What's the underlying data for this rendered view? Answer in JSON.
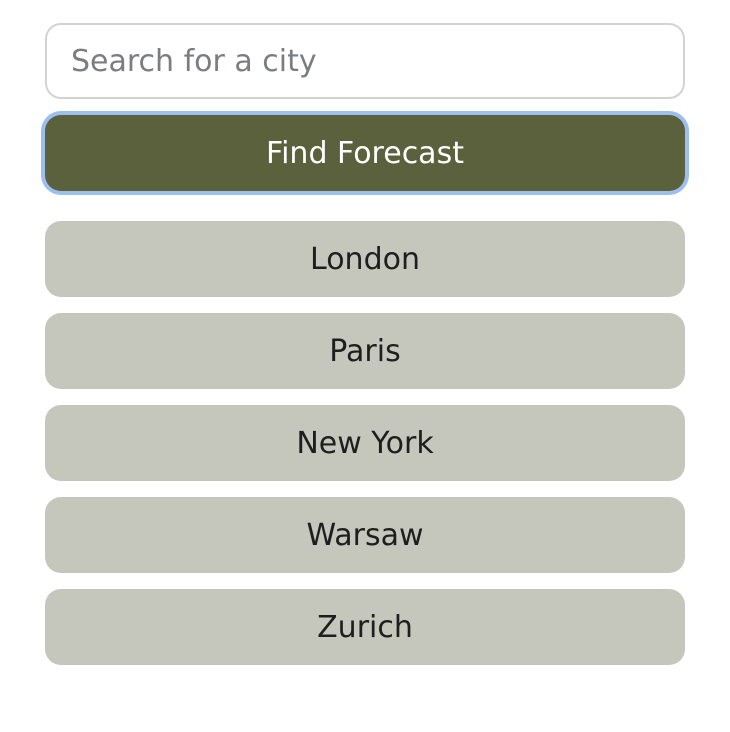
{
  "search": {
    "placeholder": "Search for a city",
    "value": ""
  },
  "find_button": {
    "label": "Find Forecast"
  },
  "cities": [
    {
      "label": "London"
    },
    {
      "label": "Paris"
    },
    {
      "label": "New York"
    },
    {
      "label": "Warsaw"
    },
    {
      "label": "Zurich"
    }
  ],
  "colors": {
    "primary_button_bg": "#5b603d",
    "focus_ring": "#9cbff0",
    "city_button_bg": "#c5c6bc",
    "input_border": "#d3d3d3",
    "placeholder_text": "#7b7e80"
  }
}
